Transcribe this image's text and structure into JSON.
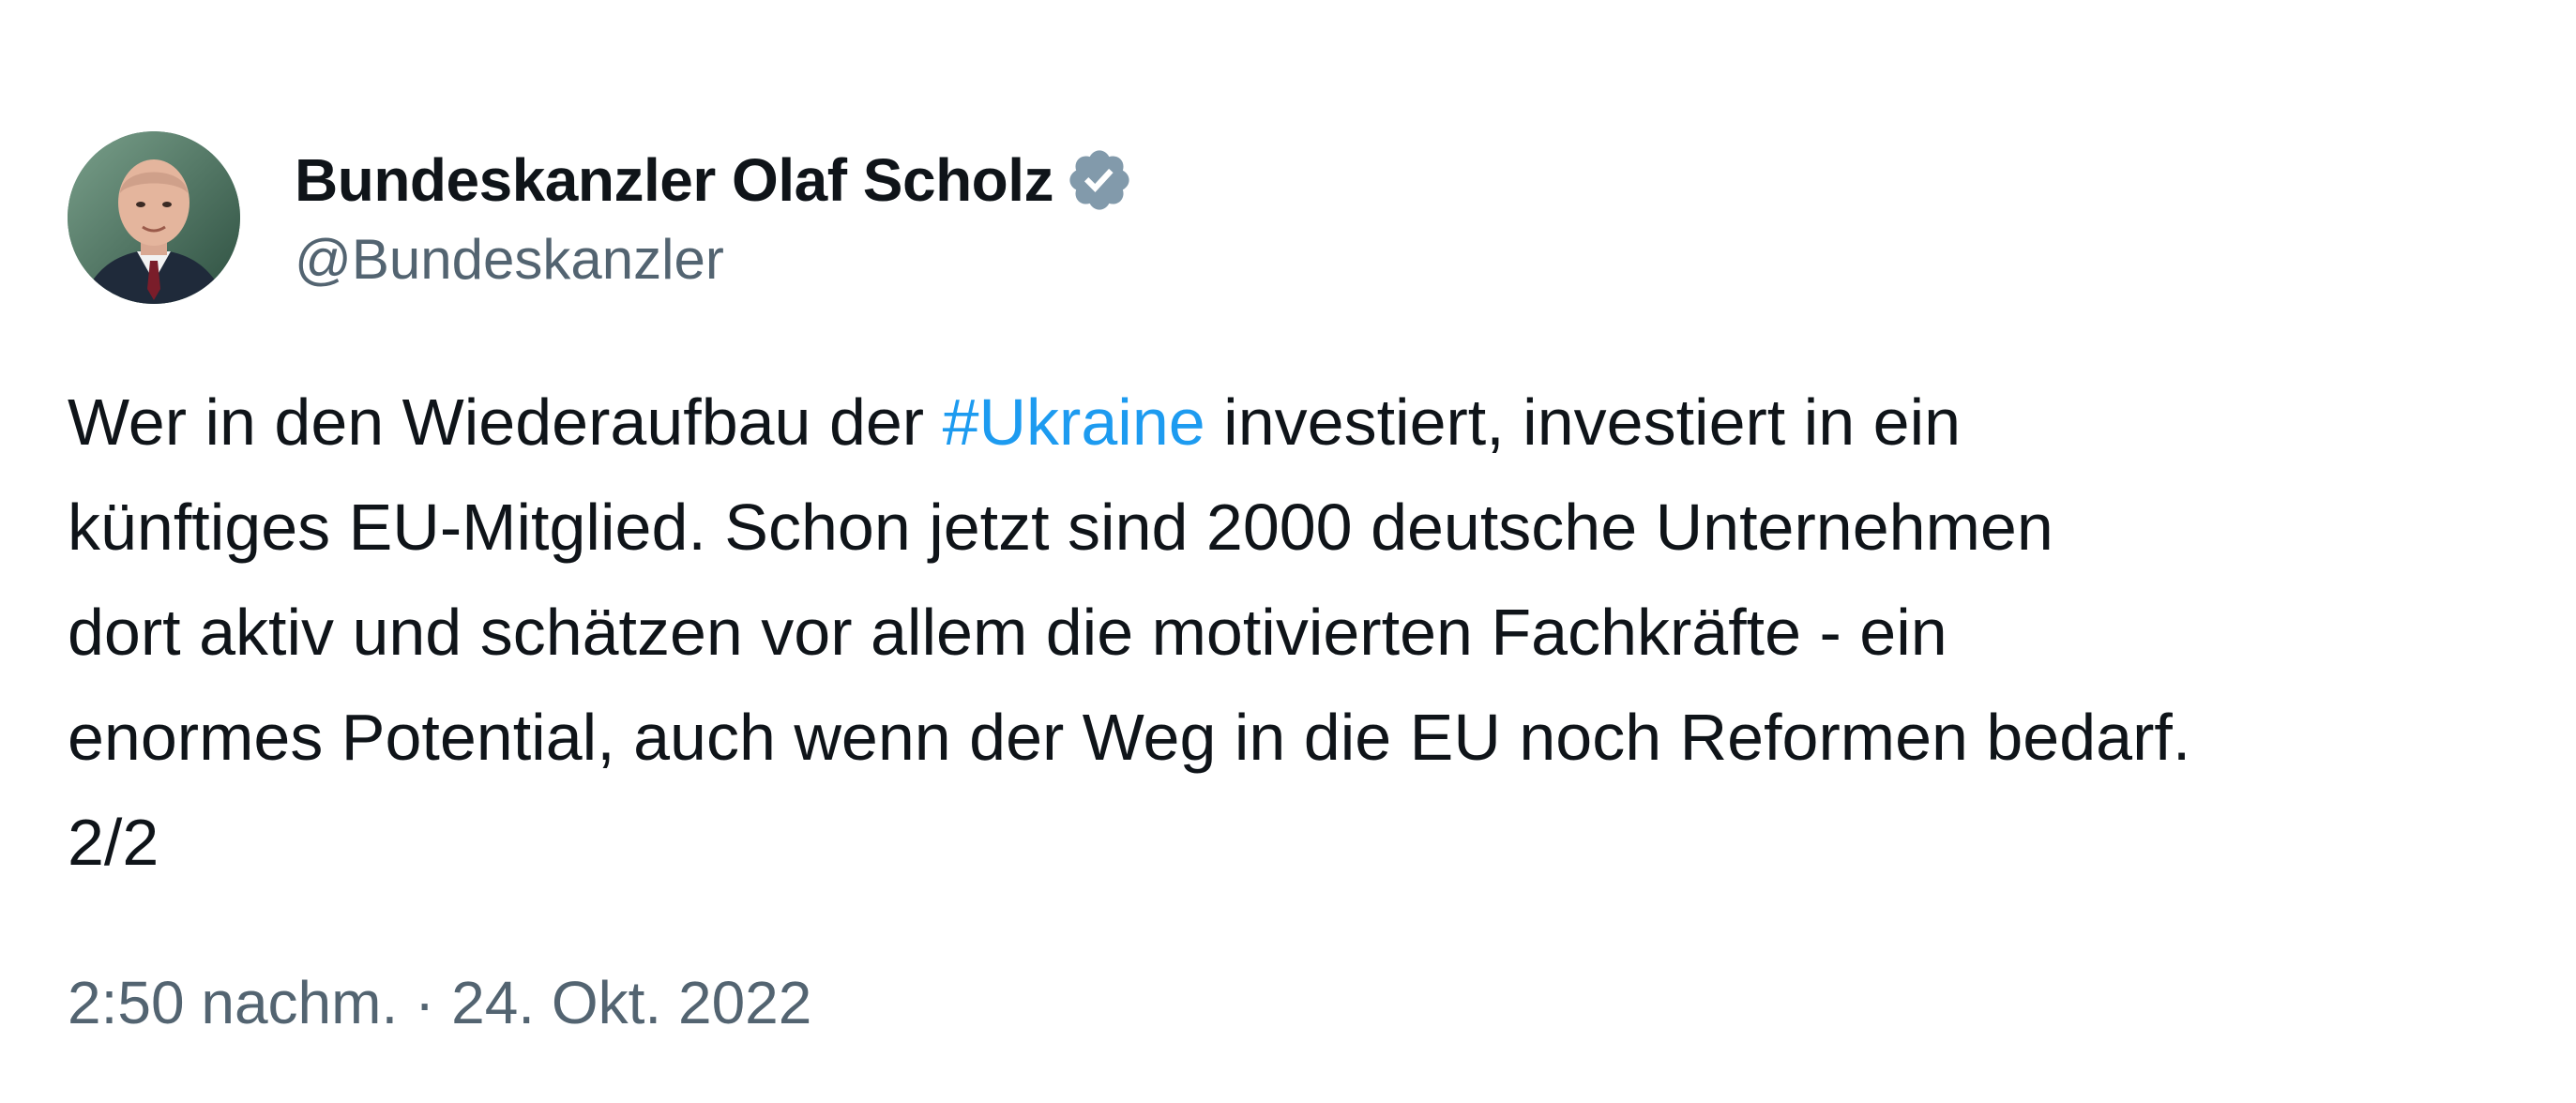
{
  "author": {
    "display_name": "Bundeskanzler Olaf Scholz",
    "handle": "@Bundeskanzler",
    "verified_icon": "verified-badge-icon",
    "verified_color": "#829aab",
    "avatar": "profile-photo"
  },
  "tweet": {
    "line1_before": "Wer in den Wiederaufbau der ",
    "hashtag": "#Ukraine",
    "line1_after": " investiert, investiert in ein",
    "line2": "künftiges EU-Mitglied. Schon jetzt sind 2000 deutsche Unternehmen",
    "line3": "dort aktiv und schätzen vor allem die motivierten Fachkräfte - ein",
    "line4": "enormes Potential, auch wenn der Weg in die EU noch Reformen bedarf.",
    "line5": "2/2",
    "hashtag_color": "#1d9bf0"
  },
  "meta": {
    "time": "2:50 nachm.",
    "separator": " · ",
    "date": "24. Okt. 2022"
  }
}
